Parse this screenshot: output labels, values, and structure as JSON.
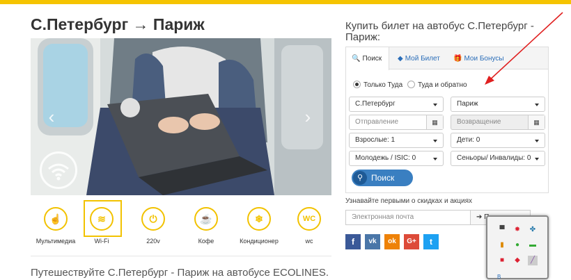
{
  "page": {
    "title": "С.Петербург → Париж",
    "subtitle": "Путешествуйте С.Петербург - Париж на автобусе ECOLINES."
  },
  "carousel": {
    "prev_label": "‹",
    "next_label": "›"
  },
  "amenities": [
    {
      "label": "Мультимедиа",
      "icon": "hand-pointer-icon",
      "glyph": "☝",
      "active": false
    },
    {
      "label": "Wi-Fi",
      "icon": "wifi-icon",
      "glyph": "≋",
      "active": true
    },
    {
      "label": "220v",
      "icon": "plug-icon",
      "glyph": "⏻",
      "active": false
    },
    {
      "label": "Кофе",
      "icon": "coffee-cup-icon",
      "glyph": "☕",
      "active": false
    },
    {
      "label": "Кондиционер",
      "icon": "snowflake-icon",
      "glyph": "❄",
      "active": false
    },
    {
      "label": "wc",
      "icon": "wc-icon",
      "glyph": "WC",
      "active": false
    }
  ],
  "booking": {
    "title": "Купить билет на автобус С.Петербург - Париж:",
    "tabs": [
      {
        "label": "Поиск",
        "icon": "search-icon",
        "glyph": "🔍"
      },
      {
        "label": "Мой Билет",
        "icon": "ticket-icon",
        "glyph": "◆"
      },
      {
        "label": "Мои Бонусы",
        "icon": "gift-icon",
        "glyph": "🎁"
      }
    ],
    "radio_oneway": "Только Туда",
    "radio_return": "Туда и обратно",
    "from_value": "С.Петербург",
    "to_value": "Париж",
    "departure_placeholder": "Отправление",
    "return_placeholder": "Возвращение",
    "adults_value": "Взрослые: 1",
    "children_value": "Дети: 0",
    "youth_value": "Молодежь / ISIC: 0",
    "seniors_value": "Сеньоры/ Инвалиды: 0",
    "search_label": "Поиск",
    "calendar_glyph": "▦"
  },
  "newsletter": {
    "label": "Узнавайте первыми о скидках и акциях",
    "email_placeholder": "Электронная почта",
    "subscribe_label": "П"
  },
  "social": [
    {
      "name": "facebook-icon",
      "glyph": "f",
      "color": "#3b5998"
    },
    {
      "name": "vk-icon",
      "glyph": "vk",
      "color": "#4a76a8"
    },
    {
      "name": "odnoklassniki-icon",
      "glyph": "ok",
      "color": "#ee8208"
    },
    {
      "name": "google-plus-icon",
      "glyph": "G+",
      "color": "#dd4b39"
    },
    {
      "name": "twitter-icon",
      "glyph": "t",
      "color": "#1da1f2"
    }
  ],
  "popup": {
    "link": "В"
  },
  "colors": {
    "accent": "#f5c400",
    "link": "#2a6db8",
    "button": "#3a7fc1",
    "arrow": "#e02020"
  }
}
